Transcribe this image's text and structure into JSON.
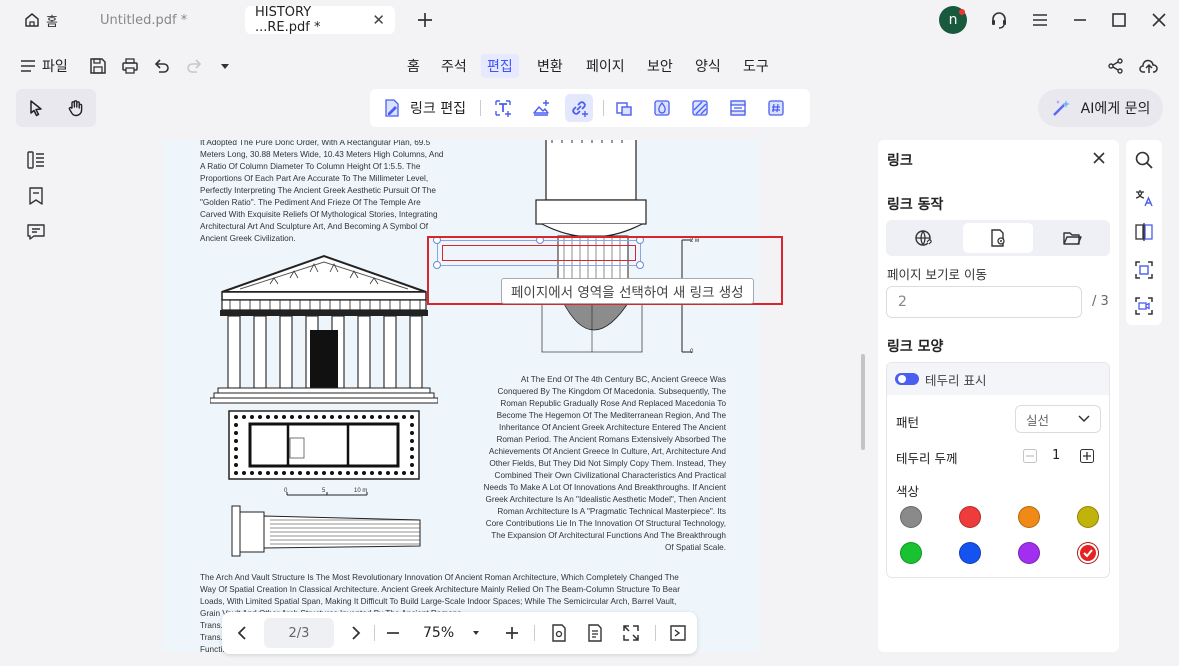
{
  "tabs": [
    {
      "label": "홈",
      "icon": "home-icon"
    },
    {
      "label": "Untitled.pdf *"
    },
    {
      "label": "HISTORY ...RE.pdf *",
      "active": true
    }
  ],
  "avatar_letter": "n",
  "menu": {
    "file_label": "파일",
    "items": [
      "홈",
      "주석",
      "편집",
      "변환",
      "페이지",
      "보안",
      "양식",
      "도구"
    ],
    "active": "편집"
  },
  "toolbar": {
    "link_edit_label": "링크 편집",
    "ai_label": "AI에게 문의"
  },
  "document": {
    "top_paragraph": [
      "It Adopted The Pure Doric Order, With A Rectangular Plan, 69.5",
      "Meters Long, 30.88 Meters Wide, 10.43 Meters High Columns, And",
      "A Ratio Of Column Diameter To Column Height Of 1:5.5. The",
      "Proportions Of Each Part Are Accurate To The Millimeter Level,",
      "Perfectly Interpreting The Ancient Greek Aesthetic Pursuit Of The",
      "\"Golden Ratio\". The Pediment And Frieze Of The Temple Are",
      "Carved With Exquisite Reliefs Of Mythological Stories, Integrating",
      "Architectural Art And Sculpture Art, And Becoming A Symbol Of",
      "Ancient Greek Civilization."
    ],
    "right_paragraph": [
      "At The End Of The 4th Century BC, Ancient Greece Was",
      "Conquered By The Kingdom Of Macedonia. Subsequently, The",
      "Roman Republic Gradually Rose And Replaced Macedonia To",
      "Become The Hegemon Of The Mediterranean Region, And The",
      "Inheritance Of Ancient Greek Architecture Entered The Ancient",
      "Roman Period. The Ancient Romans Extensively Absorbed The",
      "Achievements Of Ancient Greece In Culture, Art, Architecture And",
      "Other Fields, But They Did Not Simply Copy Them. Instead, They",
      "Combined Their Own Civilizational Characteristics And Practical",
      "Needs To Make A Lot Of Innovations And Breakthroughs. If Ancient",
      "Greek Architecture Is An \"Idealistic Aesthetic Model\", Then Ancient",
      "Roman Architecture Is A \"Pragmatic Technical Masterpiece\". Its",
      "Core Contributions Lie In The Innovation Of Structural Technology,",
      "The Expansion Of Architectural Functions And The Breakthrough",
      "Of Spatial Scale."
    ],
    "bottom_paragraph": [
      "The Arch And Vault Structure Is The Most Revolutionary Innovation Of Ancient Roman Architecture, Which Completely Changed The",
      "Way Of Spatial Creation In Classical Architecture. Ancient Greek Architecture Mainly Relied On The Beam-Column Structure To Bear",
      "Loads, With Limited Spatial Span, Making It Difficult To Build Large-Scale Indoor Spaces; While The Semicircular Arch, Barrel Vault,",
      "Grain Vault And Other Arch Structures Invented By The Ancient Romans...",
      "Trans... And",
      "Trans... he",
      "Functi... aths"
    ],
    "scale_labels": {
      "m2": "2 м",
      "m1": "1",
      "m0": "0",
      "s0": "0",
      "s5": "5",
      "s10": "10 m"
    },
    "tooltip": "페이지에서 영역을 선택하여 새 링크 생성"
  },
  "pager": {
    "page": "2/3",
    "zoom": "75%"
  },
  "panel": {
    "title": "링크",
    "action_heading": "링크 동작",
    "goto_label": "페이지 보기로 이동",
    "page_value": "2",
    "page_total": "/ 3",
    "appearance_heading": "링크 모양",
    "show_border_label": "테두리 표시",
    "pattern_label": "패턴",
    "pattern_value": "실선",
    "thickness_label": "테두리 두께",
    "thickness_value": "1",
    "color_label": "색상",
    "colors": [
      "#8a8a8a",
      "#ee3b3b",
      "#f08a16",
      "#c2b20c",
      "#19c230",
      "#1553f0",
      "#a22ff0",
      "#e52222"
    ]
  }
}
